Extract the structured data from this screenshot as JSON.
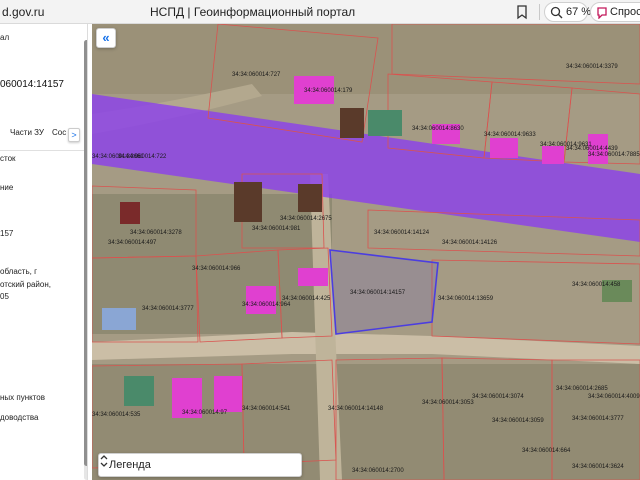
{
  "browser": {
    "url": "d.gov.ru",
    "page_title": "НСПД | Геоинформационный портал",
    "zoom": "67 %",
    "ask_label": "Спроси"
  },
  "panel": {
    "lines": [
      "ал",
      "060014:14157",
      "Части ЗУ",
      "Сос",
      "сток",
      "ние",
      "157",
      "область, г",
      "отский район,",
      "05",
      "ных пунктов",
      "доводства"
    ],
    "tab_next": ">"
  },
  "map": {
    "collapse_glyph": "«",
    "legend_label": "Легенда",
    "parcel_labels": [
      "34:34:060014:727",
      "34:34:060014:179",
      "34:34:060014:3379",
      "34:34:060014:8630",
      "34:34:060014:9633",
      "34:34:060014:9631",
      "34:34:060014:4439",
      "34:34:060014:7885",
      "34:34:060014:3661",
      "34:34:060014:722",
      "34:34:060014:2675",
      "34:34:060014:981",
      "34:34:060014:3278",
      "34:34:060014:497",
      "34:34:060014:14124",
      "34:34:060014:14126",
      "34:34:060014:966",
      "34:34:060014:964",
      "34:34:060014:3777",
      "34:34:060014:425",
      "34:34:060014:14157",
      "34:34:060014:13659",
      "34:34:060014:458",
      "34:34:060014:2685",
      "34:34:060014:4009",
      "34:34:060014:535",
      "34:34:060014:541",
      "34:34:060014:14148",
      "34:34:060014:3053",
      "34:34:060014:3074",
      "34:34:060014:3777",
      "34:34:060014:3624",
      "34:34:060014:664",
      "34:34:060014:2700",
      "34:34:060014:97",
      "34:34:060014:3059"
    ]
  },
  "colors": {
    "purple_zone": "#8a3cf0",
    "selected_parcel": "#4b3de0",
    "parcel_border": "#d9534f",
    "building_fill": "#e040d0"
  }
}
